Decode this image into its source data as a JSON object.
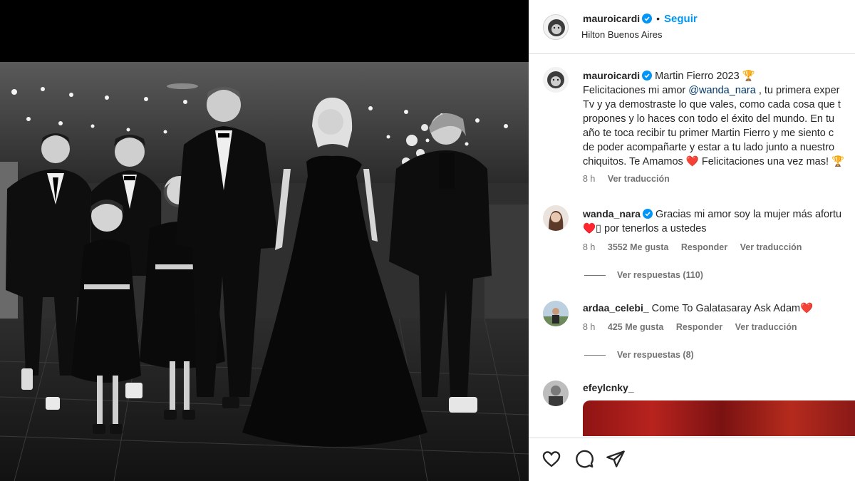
{
  "post": {
    "username": "mauroicardi",
    "follow_label": "Seguir",
    "separator": "•",
    "location": "Hilton Buenos Aires"
  },
  "caption": {
    "username": "mauroicardi",
    "line1_after_user": "Martin Fierro 2023 🏆",
    "line2_before": "Felicitaciones mi amor ",
    "mention": "@wanda_nara",
    "line2_after": " , tu primera exper",
    "line3": "Tv y ya demostraste lo que vales, como cada cosa que t",
    "line4": "propones y lo haces con todo el éxito del mundo. En tu",
    "line5": "año te toca recibir tu primer Martin Fierro y me siento c",
    "line6": "de poder acompañarte y estar a tu lado junto a nuestro",
    "line7": "chiquitos. Te Amamos ❤️ Felicitaciones una vez mas! 🏆",
    "time": "8 h",
    "translate": "Ver traducción"
  },
  "comments": [
    {
      "username": "wanda_nara",
      "text_line1": "Gracias mi amor soy la mujer más afortu",
      "text_line2": "♥️▯ por tenerlos a ustedes",
      "time": "8 h",
      "likes": "3552 Me gusta",
      "reply": "Responder",
      "translate": "Ver traducción",
      "replies": "Ver respuestas (110)"
    },
    {
      "username": "ardaa_celebi_",
      "text_line1": "Come To Galatasaray Ask Adam❤️",
      "time": "8 h",
      "likes": "425 Me gusta",
      "reply": "Responder",
      "translate": "Ver traducción",
      "replies": "Ver respuestas (8)"
    },
    {
      "username": "efeylcnky_"
    }
  ],
  "actions": {
    "like_icon": "heart-icon",
    "comment_icon": "comment-icon",
    "share_icon": "share-icon"
  },
  "colors": {
    "link_blue": "#0095f6",
    "mention_blue": "#00376b",
    "muted_gray": "#737373",
    "border": "#dbdbdb",
    "verified": "#0095f6"
  }
}
